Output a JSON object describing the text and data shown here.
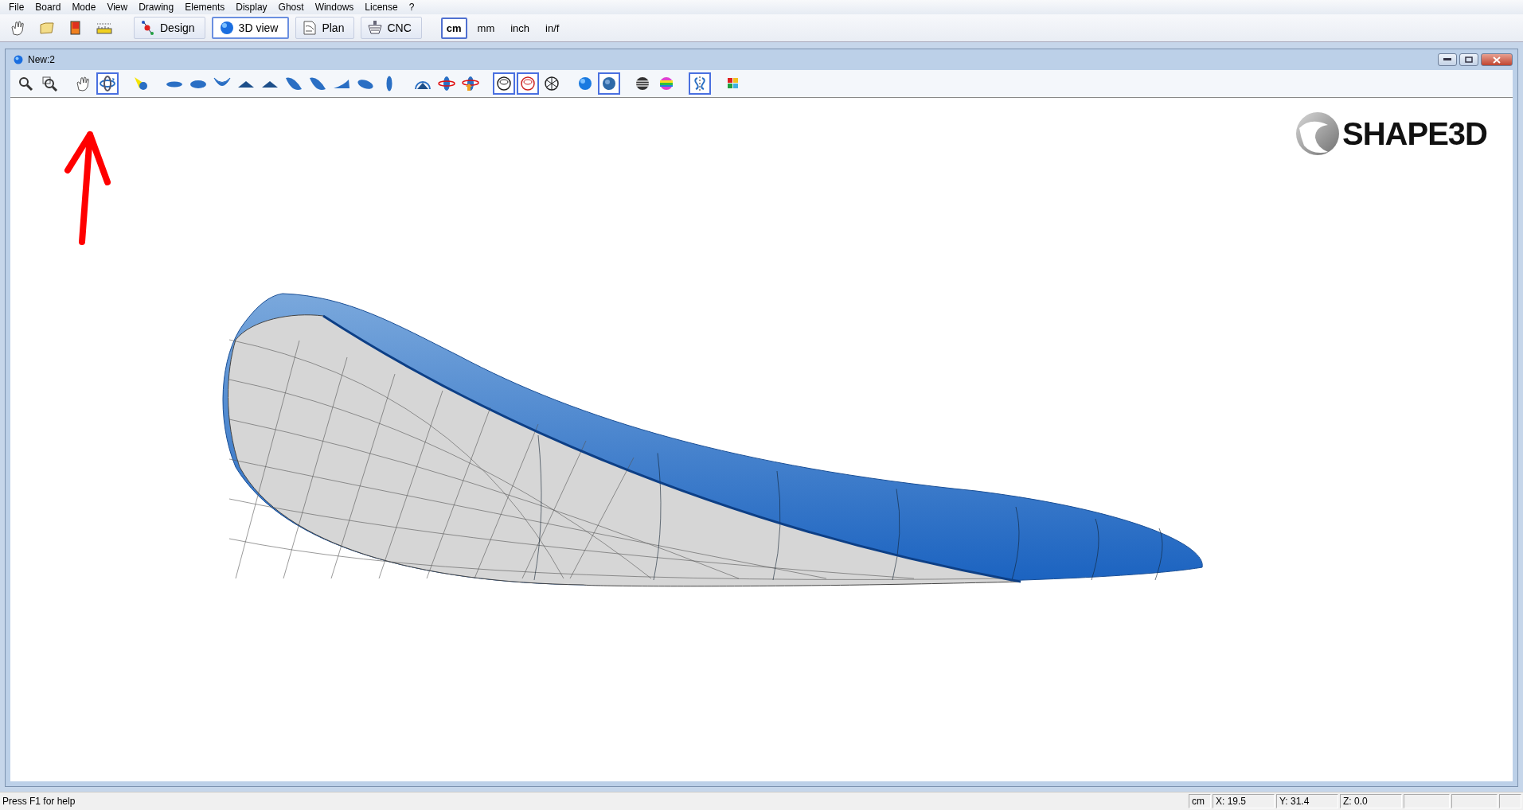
{
  "menu": [
    "File",
    "Board",
    "Mode",
    "View",
    "Drawing",
    "Elements",
    "Display",
    "Ghost",
    "Windows",
    "License",
    "?"
  ],
  "main_toolbar": {
    "icons": [
      {
        "kind": "hand"
      },
      {
        "kind": "folder"
      },
      {
        "kind": "book"
      },
      {
        "kind": "ruler"
      }
    ],
    "modes": [
      {
        "label": "Design",
        "kind": "design",
        "selected": false
      },
      {
        "label": "3D view",
        "kind": "sphere",
        "selected": true
      },
      {
        "label": "Plan",
        "kind": "plan",
        "selected": false
      },
      {
        "label": "CNC",
        "kind": "cnc",
        "selected": false
      }
    ],
    "units": [
      {
        "label": "cm",
        "selected": true
      },
      {
        "label": "mm",
        "selected": false
      },
      {
        "label": "inch",
        "selected": false
      },
      {
        "label": "in/f",
        "selected": false
      }
    ]
  },
  "document_window": {
    "title": "New:2",
    "tool_groups": [
      [
        {
          "kind": "zoom",
          "selected": false
        },
        {
          "kind": "zoom-window",
          "selected": false
        }
      ],
      [
        {
          "kind": "hand",
          "selected": false
        },
        {
          "kind": "orbit",
          "selected": true
        }
      ],
      [
        {
          "kind": "light",
          "selected": false
        }
      ],
      [
        {
          "kind": "flat-ellipse",
          "selected": false
        },
        {
          "kind": "ellipse",
          "selected": false
        },
        {
          "kind": "thin-curve",
          "selected": false
        },
        {
          "kind": "peak",
          "selected": false
        },
        {
          "kind": "peak",
          "selected": false
        },
        {
          "kind": "leaf",
          "selected": false
        },
        {
          "kind": "leaf",
          "selected": false
        },
        {
          "kind": "wedge",
          "selected": false
        },
        {
          "kind": "blob",
          "selected": false
        },
        {
          "kind": "lens",
          "selected": false
        }
      ],
      [
        {
          "kind": "rotate-arch",
          "selected": false
        },
        {
          "kind": "rotate-ring",
          "selected": false
        },
        {
          "kind": "rotate-arrow",
          "selected": false
        }
      ],
      [
        {
          "kind": "rings",
          "selected": true
        },
        {
          "kind": "rings-red",
          "selected": true
        },
        {
          "kind": "wire-ball",
          "selected": false
        }
      ],
      [
        {
          "kind": "ball",
          "selected": false
        },
        {
          "kind": "textured-ball",
          "selected": true
        }
      ],
      [
        {
          "kind": "striped-ball",
          "selected": false
        },
        {
          "kind": "rainbow-ball",
          "selected": false
        }
      ],
      [
        {
          "kind": "symmetry",
          "selected": true
        }
      ],
      [
        {
          "kind": "color-grid",
          "selected": false
        }
      ]
    ],
    "logo": "SHAPE3D"
  },
  "status_bar": {
    "help": "Press F1 for help",
    "panes": [
      "cm",
      "X: 19.5",
      "Y: 31.4",
      "Z: 0.0"
    ]
  }
}
